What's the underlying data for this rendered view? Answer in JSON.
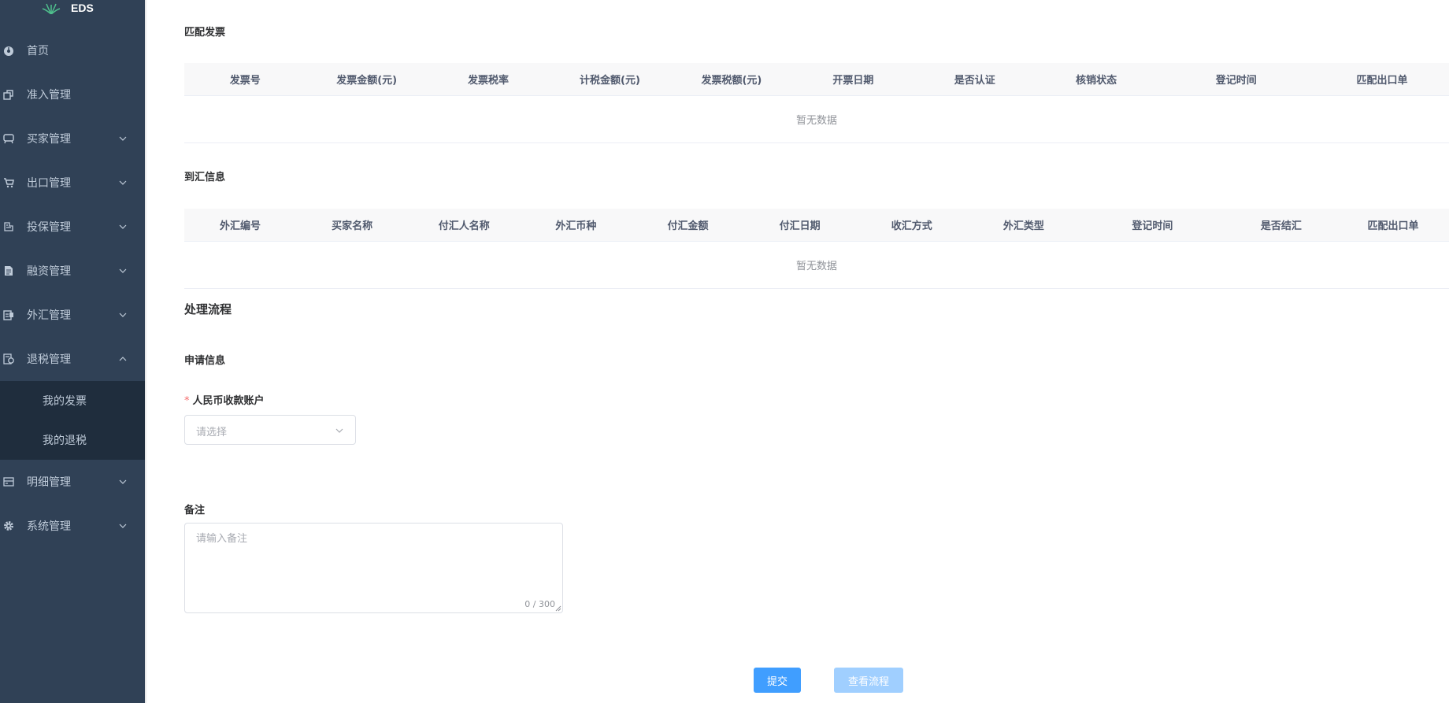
{
  "app": {
    "logo_text": "EDS"
  },
  "sidebar": {
    "items": [
      {
        "label": "首页",
        "icon": "dashboard-icon"
      },
      {
        "label": "准入管理",
        "icon": "access-icon"
      },
      {
        "label": "买家管理",
        "icon": "buyer-icon"
      },
      {
        "label": "出口管理",
        "icon": "cart-icon"
      },
      {
        "label": "投保管理",
        "icon": "insurance-icon"
      },
      {
        "label": "融资管理",
        "icon": "document-icon"
      },
      {
        "label": "外汇管理",
        "icon": "exchange-icon"
      },
      {
        "label": "退税管理",
        "icon": "tax-refund-icon"
      },
      {
        "label": "明细管理",
        "icon": "detail-icon"
      },
      {
        "label": "系统管理",
        "icon": "gear-icon"
      }
    ],
    "submenu": [
      {
        "label": "我的发票"
      },
      {
        "label": "我的退税"
      }
    ]
  },
  "invoice_section": {
    "title": "匹配发票",
    "columns": [
      "发票号",
      "发票金额(元)",
      "发票税率",
      "计税金额(元)",
      "发票税额(元)",
      "开票日期",
      "是否认证",
      "核销状态",
      "登记时间",
      "匹配出口单"
    ],
    "empty_text": "暂无数据"
  },
  "remit_section": {
    "title": "到汇信息",
    "columns": [
      "外汇编号",
      "买家名称",
      "付汇人名称",
      "外汇币种",
      "付汇金额",
      "付汇日期",
      "收汇方式",
      "外汇类型",
      "登记时间",
      "是否结汇",
      "匹配出口单"
    ],
    "empty_text": "暂无数据"
  },
  "process_title": "处理流程",
  "apply_title": "申请信息",
  "form": {
    "account_label": "人民币收款账户",
    "required_mark": "*",
    "account_placeholder": "请选择",
    "remark_label": "备注",
    "remark_placeholder": "请输入备注",
    "remark_count": "0 / 300"
  },
  "buttons": {
    "submit": "提交",
    "view_process": "查看流程"
  },
  "colors": {
    "sidebar_bg": "#304156",
    "submenu_bg": "#1f2d3d",
    "primary": "#409eff",
    "primary_disabled": "#a0cfff"
  }
}
